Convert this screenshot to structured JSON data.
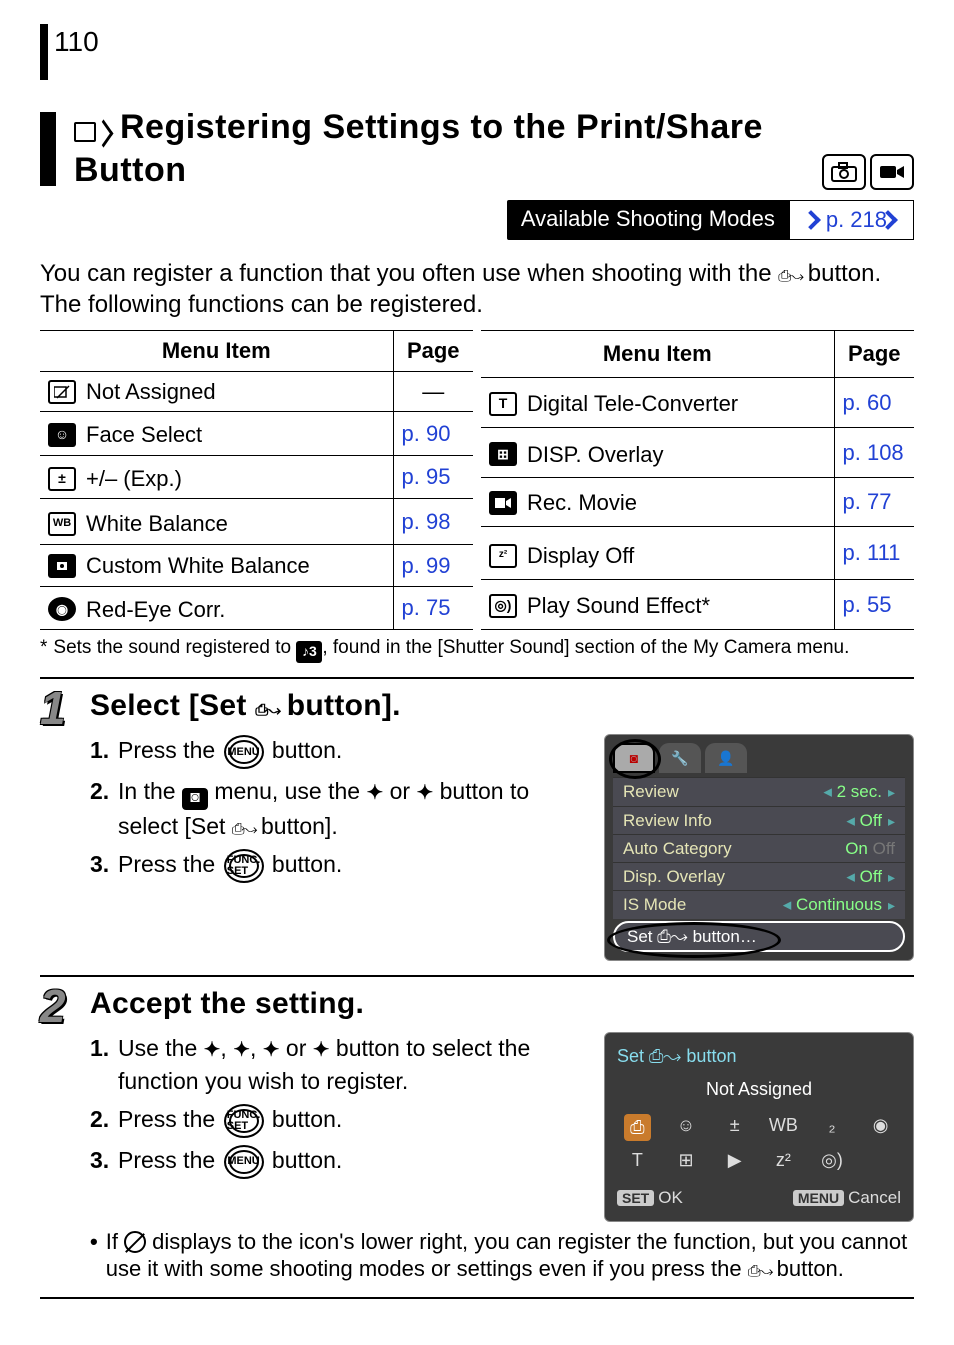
{
  "page_number": "110",
  "heading": {
    "title_part1": "Registering Settings to the Print/Share Button"
  },
  "shooting_modes": {
    "label": "Available Shooting Modes",
    "page_ref": "p. 218"
  },
  "intro": {
    "line1": "You can register a function that you often use when shooting with the",
    "line2_after_icon": " button. The following functions can be registered."
  },
  "table_headers": {
    "menu_item": "Menu Item",
    "page": "Page"
  },
  "table_left": [
    {
      "label": "Not Assigned",
      "page": "—",
      "dash": true
    },
    {
      "label": "Face Select",
      "page": "p. 90"
    },
    {
      "label": "+/– (Exp.)",
      "page": "p. 95"
    },
    {
      "label": "White Balance",
      "page": "p. 98"
    },
    {
      "label": "Custom White Balance",
      "page": "p. 99"
    },
    {
      "label": "Red-Eye Corr.",
      "page": "p. 75"
    }
  ],
  "table_right": [
    {
      "label": "Digital Tele-Converter",
      "page": "p. 60"
    },
    {
      "label": "DISP. Overlay",
      "page": "p. 108"
    },
    {
      "label": "Rec. Movie",
      "page": "p. 77"
    },
    {
      "label": "Display Off",
      "page": "p. 111"
    },
    {
      "label": "Play Sound Effect*",
      "page": "p. 55"
    }
  ],
  "footnote": "Sets the sound registered to ",
  "footnote_after_icon": ", found in the [Shutter Sound] section of the My Camera menu.",
  "step1": {
    "title_prefix": "Select [Set ",
    "title_suffix": " button].",
    "sub1_before": "Press the ",
    "sub1_after": " button.",
    "sub2_before": "In the ",
    "sub2_mid": " menu, use the ",
    "sub2_or": " or ",
    "sub2_end_pre": " button to select [Set ",
    "sub2_end_post": " button].",
    "sub3_before": "Press the ",
    "sub3_after": " button.",
    "lcd": {
      "rows": [
        {
          "label": "Review",
          "value": "2 sec."
        },
        {
          "label": "Review Info",
          "value": "Off"
        },
        {
          "label": "Auto Category",
          "value": "On",
          "extra": "Off"
        },
        {
          "label": "Disp. Overlay",
          "value": "Off"
        },
        {
          "label": "IS Mode",
          "value": "Continuous"
        }
      ],
      "highlight": "Set ⎙↝ button…"
    }
  },
  "step2": {
    "title": "Accept the setting.",
    "sub1_before": "Use the ",
    "sub1_sep": ", ",
    "sub1_or": " or ",
    "sub1_after": " button to select the function you wish to register.",
    "sub2_before": "Press the ",
    "sub2_after": " button.",
    "sub3_before": "Press the ",
    "sub3_after": " button.",
    "bullet_before": "If ",
    "bullet_after": " displays to the icon's lower right, you can register the function, but you cannot use it with some shooting modes or settings even if you press the ",
    "bullet_end": " button.",
    "lcd": {
      "title": "Set ⎙↝ button",
      "subtitle": "Not Assigned",
      "ok": "OK",
      "cancel": "Cancel",
      "set": "SET",
      "menu": "MENU"
    }
  }
}
